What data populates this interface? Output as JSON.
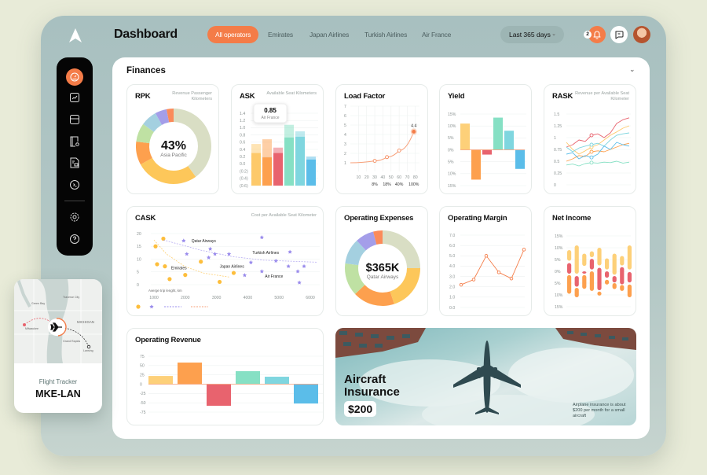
{
  "header": {
    "title": "Dashboard",
    "tabs": [
      "All operators",
      "Emirates",
      "Japan Airlines",
      "Turkish Airlines",
      "Air France"
    ],
    "active_tab": 0,
    "range": "Last 365 days",
    "notifications": "2"
  },
  "sidebar": {
    "items": [
      "dashboard-icon",
      "trend-chart-icon",
      "database-icon",
      "document-search-icon",
      "report-icon",
      "terminal-chat-icon",
      "settings-icon",
      "help-icon"
    ]
  },
  "section": {
    "title": "Finances"
  },
  "colors": {
    "accent": "#f47c48",
    "yellow": "#fdd079",
    "orange": "#fda04e",
    "red": "#e8636e",
    "green": "#86e0c4",
    "cyan": "#7fd6df",
    "blue": "#5bbde9",
    "olive": "#d9dec4",
    "lightgreen": "#bfe1a3",
    "lightblue": "#a4d0e0",
    "purple": "#a49ee9",
    "coral": "#fb8b5a"
  },
  "chart_data": [
    {
      "type": "pie",
      "title": "RPK",
      "subtitle": "Revenue Passenger Kilometers",
      "center_value": "43%",
      "center_label": "Asia Pacific",
      "values": [
        40,
        27,
        10,
        8,
        7,
        5,
        3
      ],
      "colors": [
        "#d9dec4",
        "#fdc75a",
        "#fda04e",
        "#bfe1a3",
        "#a4d0e0",
        "#a49ee9",
        "#fb8b5a"
      ]
    },
    {
      "type": "bar",
      "title": "ASK",
      "subtitle": "Available Seat Kilometers",
      "ylim": [
        -0.6,
        1.4
      ],
      "yticks": [
        "1.4",
        "1.2",
        "1.0",
        "0.8",
        "0.6",
        "0.4",
        "0.2",
        "0.0",
        "(0.2)",
        "(0.4)",
        "(0.6)"
      ],
      "values": [
        0.55,
        0.68,
        0.45,
        1.08,
        0.9,
        0.2
      ],
      "inner_values": [
        0.3,
        0.18,
        0.3,
        0.73,
        0.75,
        0.12
      ],
      "colors": [
        "#fdc96a",
        "#fda04e",
        "#e8636e",
        "#86e0c4",
        "#7fd6df",
        "#5bbde9"
      ],
      "tooltip": {
        "value": "0.85",
        "label": "Air France"
      }
    },
    {
      "type": "line",
      "title": "Load Factor",
      "ylim": [
        1,
        7
      ],
      "yticks": [
        "7",
        "6",
        "5",
        "4",
        "3",
        "2",
        "1"
      ],
      "xlim": [
        0,
        85
      ],
      "xticks": [
        "10",
        "20",
        "30",
        "40",
        "50",
        "60",
        "70",
        "80"
      ],
      "xticks_pct": [
        "8%",
        "18%",
        "40%",
        "100%"
      ],
      "points": [
        [
          0,
          1.0
        ],
        [
          30,
          1.2
        ],
        [
          45,
          1.6
        ],
        [
          60,
          2.3
        ],
        [
          78,
          4.3
        ]
      ],
      "point_label": "4.4"
    },
    {
      "type": "bar",
      "title": "Yield",
      "ylim": [
        -15,
        15
      ],
      "yticks": [
        "15%",
        "10%",
        "5%",
        "0%",
        "5%",
        "10%",
        "15%"
      ],
      "values": [
        11,
        -12.5,
        -2,
        13.5,
        8,
        -8
      ],
      "colors": [
        "#fdd079",
        "#fda04e",
        "#e8636e",
        "#86e0c4",
        "#7fd6df",
        "#5bbde9"
      ]
    },
    {
      "type": "line",
      "title": "RASK",
      "subtitle": "Revenue per Available Seat Kilometer",
      "ylim": [
        0,
        1.5
      ],
      "yticks": [
        "1.5",
        "1.25",
        "1",
        "0.75",
        "0.5",
        "0.25",
        "0"
      ],
      "series": [
        {
          "color": "#e8636e",
          "values": [
            0.8,
            0.85,
            0.95,
            0.92,
            1.05,
            1.08,
            1.0,
            1.1,
            1.3,
            1.38,
            1.42
          ],
          "marker": 4
        },
        {
          "color": "#fdc96a",
          "values": [
            0.9,
            0.75,
            0.65,
            0.72,
            0.8,
            0.85,
            0.95,
            1.05,
            1.12,
            1.2,
            1.25
          ],
          "marker": 4
        },
        {
          "color": "#7fd6df",
          "values": [
            0.8,
            0.7,
            0.78,
            0.82,
            0.85,
            0.88,
            0.82,
            0.95,
            1.05,
            1.08,
            1.1
          ],
          "marker": 4
        },
        {
          "color": "#fda04e",
          "values": [
            0.5,
            0.55,
            0.62,
            0.6,
            0.7,
            0.72,
            0.7,
            0.75,
            0.8,
            0.85,
            0.88
          ],
          "marker": 4
        },
        {
          "color": "#5bbde9",
          "values": [
            0.65,
            0.68,
            0.55,
            0.62,
            0.58,
            0.65,
            0.82,
            0.75,
            0.9,
            0.85,
            0.82
          ],
          "marker": 4
        },
        {
          "color": "#86e0c4",
          "values": [
            0.42,
            0.44,
            0.4,
            0.45,
            0.47,
            0.46,
            0.48,
            0.47,
            0.5,
            0.46,
            0.48
          ],
          "marker": 4
        }
      ]
    },
    {
      "type": "scatter",
      "title": "CASK",
      "subtitle": "Cost per Available Seat Kilometer",
      "xlabel": "Averge trip lenght, km",
      "xlim": [
        1000,
        6000
      ],
      "ylim": [
        0,
        20
      ],
      "xticks": [
        "1000",
        "2000",
        "3000",
        "4000",
        "5000",
        "6000"
      ],
      "yticks": [
        "20",
        "15",
        "10",
        "5",
        "0"
      ],
      "series": [
        {
          "color": "#fdbe3c",
          "shape": "circle",
          "points": [
            [
              1050,
              15
            ],
            [
              1100,
              8
            ],
            [
              1300,
              18
            ],
            [
              1350,
              7.2
            ],
            [
              1500,
              2.2
            ],
            [
              2000,
              3.8
            ],
            [
              2500,
              9
            ],
            [
              3100,
              1.1
            ],
            [
              3550,
              4.6
            ]
          ],
          "trend": [
            [
              1000,
              17.5
            ],
            [
              1400,
              12
            ],
            [
              2000,
              7
            ],
            [
              2600,
              4.5
            ],
            [
              3400,
              3
            ]
          ]
        },
        {
          "color": "#9a8cec",
          "shape": "star",
          "points": [
            [
              1950,
              17.2
            ],
            [
              2050,
              12
            ],
            [
              2750,
              10.6
            ],
            [
              2800,
              14
            ],
            [
              2950,
              12
            ],
            [
              3400,
              12
            ],
            [
              3900,
              3.7
            ],
            [
              4100,
              8.7
            ],
            [
              4450,
              18.5
            ],
            [
              4450,
              5.2
            ],
            [
              4900,
              9.3
            ],
            [
              5300,
              7.2
            ],
            [
              5350,
              12.8
            ],
            [
              5600,
              5.2
            ],
            [
              5650,
              0.8
            ],
            [
              5800,
              7.2
            ]
          ],
          "trend": [
            [
              1300,
              17.5
            ],
            [
              2500,
              13.5
            ],
            [
              3500,
              11
            ],
            [
              4500,
              9.6
            ],
            [
              6200,
              8.8
            ]
          ]
        }
      ],
      "labels": [
        {
          "text": "Qatar Airways",
          "x": 2200,
          "y": 17.2
        },
        {
          "text": "Turkish Airlines",
          "x": 4150,
          "y": 12.5
        },
        {
          "text": "Japan Airlines",
          "x": 3100,
          "y": 7.2
        },
        {
          "text": "Emirates",
          "x": 1550,
          "y": 6.6
        },
        {
          "text": "Air France",
          "x": 4550,
          "y": 3.3
        }
      ]
    },
    {
      "type": "pie",
      "title": "Operating Expenses",
      "center_value": "$365K",
      "center_label": "Qatar Airways",
      "values": [
        25,
        20,
        18,
        14,
        11,
        8,
        4
      ],
      "colors": [
        "#d9dec4",
        "#fdc75a",
        "#fda04e",
        "#bfe1a3",
        "#a4d0e0",
        "#a49ee9",
        "#fb8b5a"
      ]
    },
    {
      "type": "line",
      "title": "Operating Margin",
      "ylim": [
        0,
        7
      ],
      "yticks": [
        "7.0",
        "6.0",
        "5.0",
        "4.0",
        "3.0",
        "2.0",
        "1.0",
        "0.0"
      ],
      "values": [
        2.2,
        2.7,
        5.0,
        3.4,
        2.8,
        5.6
      ],
      "color": "#f47c48"
    },
    {
      "type": "bar",
      "title": "Net Income",
      "ylim": [
        -15,
        15
      ],
      "yticks": [
        "15%",
        "10%",
        "5%",
        "0%",
        "5%",
        "10%",
        "15%"
      ],
      "columns": [
        [
          [
            4.5,
            9,
            "#fdd079"
          ],
          [
            -1,
            3.5,
            "#e8636e"
          ],
          [
            -9.5,
            -1.6,
            "#fda04e"
          ]
        ],
        [
          [
            -1,
            11,
            "#fdd079"
          ],
          [
            -6.5,
            -2,
            "#e8636e"
          ],
          [
            -11,
            -7,
            "#fda04e"
          ]
        ],
        [
          [
            2.3,
            7.5,
            "#fdd079"
          ],
          [
            -1,
            0,
            "#e8636e"
          ],
          [
            -7.4,
            -1.6,
            "#fda04e"
          ]
        ],
        [
          [
            6,
            8.5,
            "#fdd079"
          ],
          [
            0.8,
            5.3,
            "#e8636e"
          ],
          [
            -8.3,
            0,
            "#fda04e"
          ]
        ],
        [
          [
            2.5,
            10,
            "#fdd079"
          ],
          [
            -8,
            1.5,
            "#e8636e"
          ],
          [
            -10.3,
            -8.6,
            "#fda04e"
          ]
        ],
        [
          [
            0.8,
            5.5,
            "#fdd079"
          ],
          [
            -2.7,
            0,
            "#e8636e"
          ],
          [
            -5.6,
            -3.6,
            "#fda04e"
          ]
        ],
        [
          [
            -1.4,
            7.5,
            "#fdd079"
          ],
          [
            -4.7,
            -2,
            "#e8636e"
          ],
          [
            -7.5,
            -5,
            "#fda04e"
          ]
        ],
        [
          [
            2.5,
            6.5,
            "#fdd079"
          ],
          [
            -5.5,
            1.8,
            "#e8636e"
          ],
          [
            -8.3,
            -5.8,
            "#fda04e"
          ]
        ],
        [
          [
            0.8,
            11,
            "#fdd079"
          ],
          [
            -4.7,
            -0.3,
            "#e8636e"
          ],
          [
            -11,
            -5.6,
            "#fda04e"
          ]
        ]
      ]
    },
    {
      "type": "bar",
      "title": "Operating Revenue",
      "ylim": [
        -75,
        75
      ],
      "yticks": [
        "75",
        "50",
        "25",
        "0",
        "-25",
        "-50",
        "-75"
      ],
      "values": [
        22,
        58,
        -58,
        35,
        20,
        -52
      ],
      "colors": [
        "#fdd079",
        "#fda04e",
        "#e8636e",
        "#86e0c4",
        "#7fd6df",
        "#5bbde9"
      ]
    }
  ],
  "promo": {
    "title": "Aircraft Insurance",
    "price": "$200",
    "note": "Airplane insurance is about $200 per month for a small aircraft"
  },
  "tracker": {
    "label": "Flight Tracker",
    "route": "MKE-LAN",
    "map_labels": [
      "Green Bay",
      "MICHIGAN",
      "Milwaukee",
      "Lansing",
      "Grand Rapids",
      "Traverse City"
    ]
  }
}
